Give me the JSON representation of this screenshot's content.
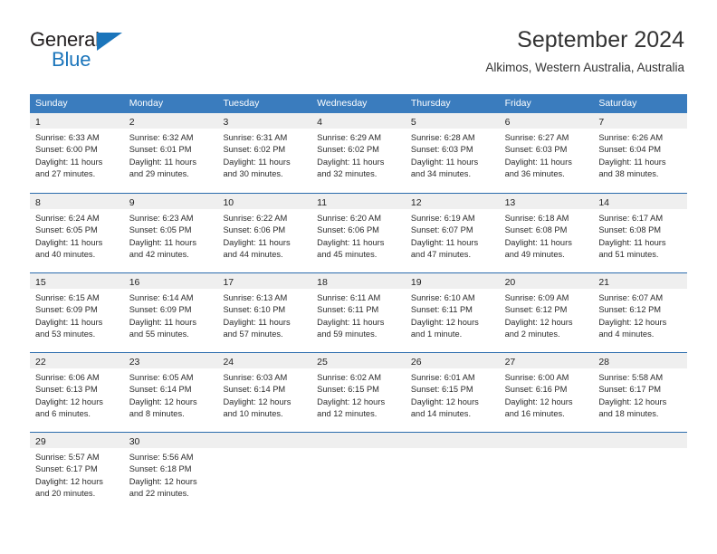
{
  "brand": {
    "name_part1": "General",
    "name_part2": "Blue",
    "flag_icon": "triangle-flag-icon"
  },
  "header": {
    "title": "September 2024",
    "location": "Alkimos, Western Australia, Australia"
  },
  "calendar": {
    "weekday_headers": [
      "Sunday",
      "Monday",
      "Tuesday",
      "Wednesday",
      "Thursday",
      "Friday",
      "Saturday"
    ],
    "colors": {
      "header_blue": "#3a7cbe",
      "row_separator_blue": "#2b6cad",
      "day_band_gray": "#efefef",
      "brand_blue": "#1b75bb",
      "text": "#2b2b2b"
    },
    "weeks": [
      {
        "days": [
          {
            "number": "1",
            "sunrise": "Sunrise: 6:33 AM",
            "sunset": "Sunset: 6:00 PM",
            "daylight_line1": "Daylight: 11 hours",
            "daylight_line2": "and 27 minutes."
          },
          {
            "number": "2",
            "sunrise": "Sunrise: 6:32 AM",
            "sunset": "Sunset: 6:01 PM",
            "daylight_line1": "Daylight: 11 hours",
            "daylight_line2": "and 29 minutes."
          },
          {
            "number": "3",
            "sunrise": "Sunrise: 6:31 AM",
            "sunset": "Sunset: 6:02 PM",
            "daylight_line1": "Daylight: 11 hours",
            "daylight_line2": "and 30 minutes."
          },
          {
            "number": "4",
            "sunrise": "Sunrise: 6:29 AM",
            "sunset": "Sunset: 6:02 PM",
            "daylight_line1": "Daylight: 11 hours",
            "daylight_line2": "and 32 minutes."
          },
          {
            "number": "5",
            "sunrise": "Sunrise: 6:28 AM",
            "sunset": "Sunset: 6:03 PM",
            "daylight_line1": "Daylight: 11 hours",
            "daylight_line2": "and 34 minutes."
          },
          {
            "number": "6",
            "sunrise": "Sunrise: 6:27 AM",
            "sunset": "Sunset: 6:03 PM",
            "daylight_line1": "Daylight: 11 hours",
            "daylight_line2": "and 36 minutes."
          },
          {
            "number": "7",
            "sunrise": "Sunrise: 6:26 AM",
            "sunset": "Sunset: 6:04 PM",
            "daylight_line1": "Daylight: 11 hours",
            "daylight_line2": "and 38 minutes."
          }
        ]
      },
      {
        "days": [
          {
            "number": "8",
            "sunrise": "Sunrise: 6:24 AM",
            "sunset": "Sunset: 6:05 PM",
            "daylight_line1": "Daylight: 11 hours",
            "daylight_line2": "and 40 minutes."
          },
          {
            "number": "9",
            "sunrise": "Sunrise: 6:23 AM",
            "sunset": "Sunset: 6:05 PM",
            "daylight_line1": "Daylight: 11 hours",
            "daylight_line2": "and 42 minutes."
          },
          {
            "number": "10",
            "sunrise": "Sunrise: 6:22 AM",
            "sunset": "Sunset: 6:06 PM",
            "daylight_line1": "Daylight: 11 hours",
            "daylight_line2": "and 44 minutes."
          },
          {
            "number": "11",
            "sunrise": "Sunrise: 6:20 AM",
            "sunset": "Sunset: 6:06 PM",
            "daylight_line1": "Daylight: 11 hours",
            "daylight_line2": "and 45 minutes."
          },
          {
            "number": "12",
            "sunrise": "Sunrise: 6:19 AM",
            "sunset": "Sunset: 6:07 PM",
            "daylight_line1": "Daylight: 11 hours",
            "daylight_line2": "and 47 minutes."
          },
          {
            "number": "13",
            "sunrise": "Sunrise: 6:18 AM",
            "sunset": "Sunset: 6:08 PM",
            "daylight_line1": "Daylight: 11 hours",
            "daylight_line2": "and 49 minutes."
          },
          {
            "number": "14",
            "sunrise": "Sunrise: 6:17 AM",
            "sunset": "Sunset: 6:08 PM",
            "daylight_line1": "Daylight: 11 hours",
            "daylight_line2": "and 51 minutes."
          }
        ]
      },
      {
        "days": [
          {
            "number": "15",
            "sunrise": "Sunrise: 6:15 AM",
            "sunset": "Sunset: 6:09 PM",
            "daylight_line1": "Daylight: 11 hours",
            "daylight_line2": "and 53 minutes."
          },
          {
            "number": "16",
            "sunrise": "Sunrise: 6:14 AM",
            "sunset": "Sunset: 6:09 PM",
            "daylight_line1": "Daylight: 11 hours",
            "daylight_line2": "and 55 minutes."
          },
          {
            "number": "17",
            "sunrise": "Sunrise: 6:13 AM",
            "sunset": "Sunset: 6:10 PM",
            "daylight_line1": "Daylight: 11 hours",
            "daylight_line2": "and 57 minutes."
          },
          {
            "number": "18",
            "sunrise": "Sunrise: 6:11 AM",
            "sunset": "Sunset: 6:11 PM",
            "daylight_line1": "Daylight: 11 hours",
            "daylight_line2": "and 59 minutes."
          },
          {
            "number": "19",
            "sunrise": "Sunrise: 6:10 AM",
            "sunset": "Sunset: 6:11 PM",
            "daylight_line1": "Daylight: 12 hours",
            "daylight_line2": "and 1 minute."
          },
          {
            "number": "20",
            "sunrise": "Sunrise: 6:09 AM",
            "sunset": "Sunset: 6:12 PM",
            "daylight_line1": "Daylight: 12 hours",
            "daylight_line2": "and 2 minutes."
          },
          {
            "number": "21",
            "sunrise": "Sunrise: 6:07 AM",
            "sunset": "Sunset: 6:12 PM",
            "daylight_line1": "Daylight: 12 hours",
            "daylight_line2": "and 4 minutes."
          }
        ]
      },
      {
        "days": [
          {
            "number": "22",
            "sunrise": "Sunrise: 6:06 AM",
            "sunset": "Sunset: 6:13 PM",
            "daylight_line1": "Daylight: 12 hours",
            "daylight_line2": "and 6 minutes."
          },
          {
            "number": "23",
            "sunrise": "Sunrise: 6:05 AM",
            "sunset": "Sunset: 6:14 PM",
            "daylight_line1": "Daylight: 12 hours",
            "daylight_line2": "and 8 minutes."
          },
          {
            "number": "24",
            "sunrise": "Sunrise: 6:03 AM",
            "sunset": "Sunset: 6:14 PM",
            "daylight_line1": "Daylight: 12 hours",
            "daylight_line2": "and 10 minutes."
          },
          {
            "number": "25",
            "sunrise": "Sunrise: 6:02 AM",
            "sunset": "Sunset: 6:15 PM",
            "daylight_line1": "Daylight: 12 hours",
            "daylight_line2": "and 12 minutes."
          },
          {
            "number": "26",
            "sunrise": "Sunrise: 6:01 AM",
            "sunset": "Sunset: 6:15 PM",
            "daylight_line1": "Daylight: 12 hours",
            "daylight_line2": "and 14 minutes."
          },
          {
            "number": "27",
            "sunrise": "Sunrise: 6:00 AM",
            "sunset": "Sunset: 6:16 PM",
            "daylight_line1": "Daylight: 12 hours",
            "daylight_line2": "and 16 minutes."
          },
          {
            "number": "28",
            "sunrise": "Sunrise: 5:58 AM",
            "sunset": "Sunset: 6:17 PM",
            "daylight_line1": "Daylight: 12 hours",
            "daylight_line2": "and 18 minutes."
          }
        ]
      },
      {
        "days": [
          {
            "number": "29",
            "sunrise": "Sunrise: 5:57 AM",
            "sunset": "Sunset: 6:17 PM",
            "daylight_line1": "Daylight: 12 hours",
            "daylight_line2": "and 20 minutes."
          },
          {
            "number": "30",
            "sunrise": "Sunrise: 5:56 AM",
            "sunset": "Sunset: 6:18 PM",
            "daylight_line1": "Daylight: 12 hours",
            "daylight_line2": "and 22 minutes."
          },
          {
            "number": "",
            "sunrise": "",
            "sunset": "",
            "daylight_line1": "",
            "daylight_line2": ""
          },
          {
            "number": "",
            "sunrise": "",
            "sunset": "",
            "daylight_line1": "",
            "daylight_line2": ""
          },
          {
            "number": "",
            "sunrise": "",
            "sunset": "",
            "daylight_line1": "",
            "daylight_line2": ""
          },
          {
            "number": "",
            "sunrise": "",
            "sunset": "",
            "daylight_line1": "",
            "daylight_line2": ""
          },
          {
            "number": "",
            "sunrise": "",
            "sunset": "",
            "daylight_line1": "",
            "daylight_line2": ""
          }
        ]
      }
    ]
  }
}
